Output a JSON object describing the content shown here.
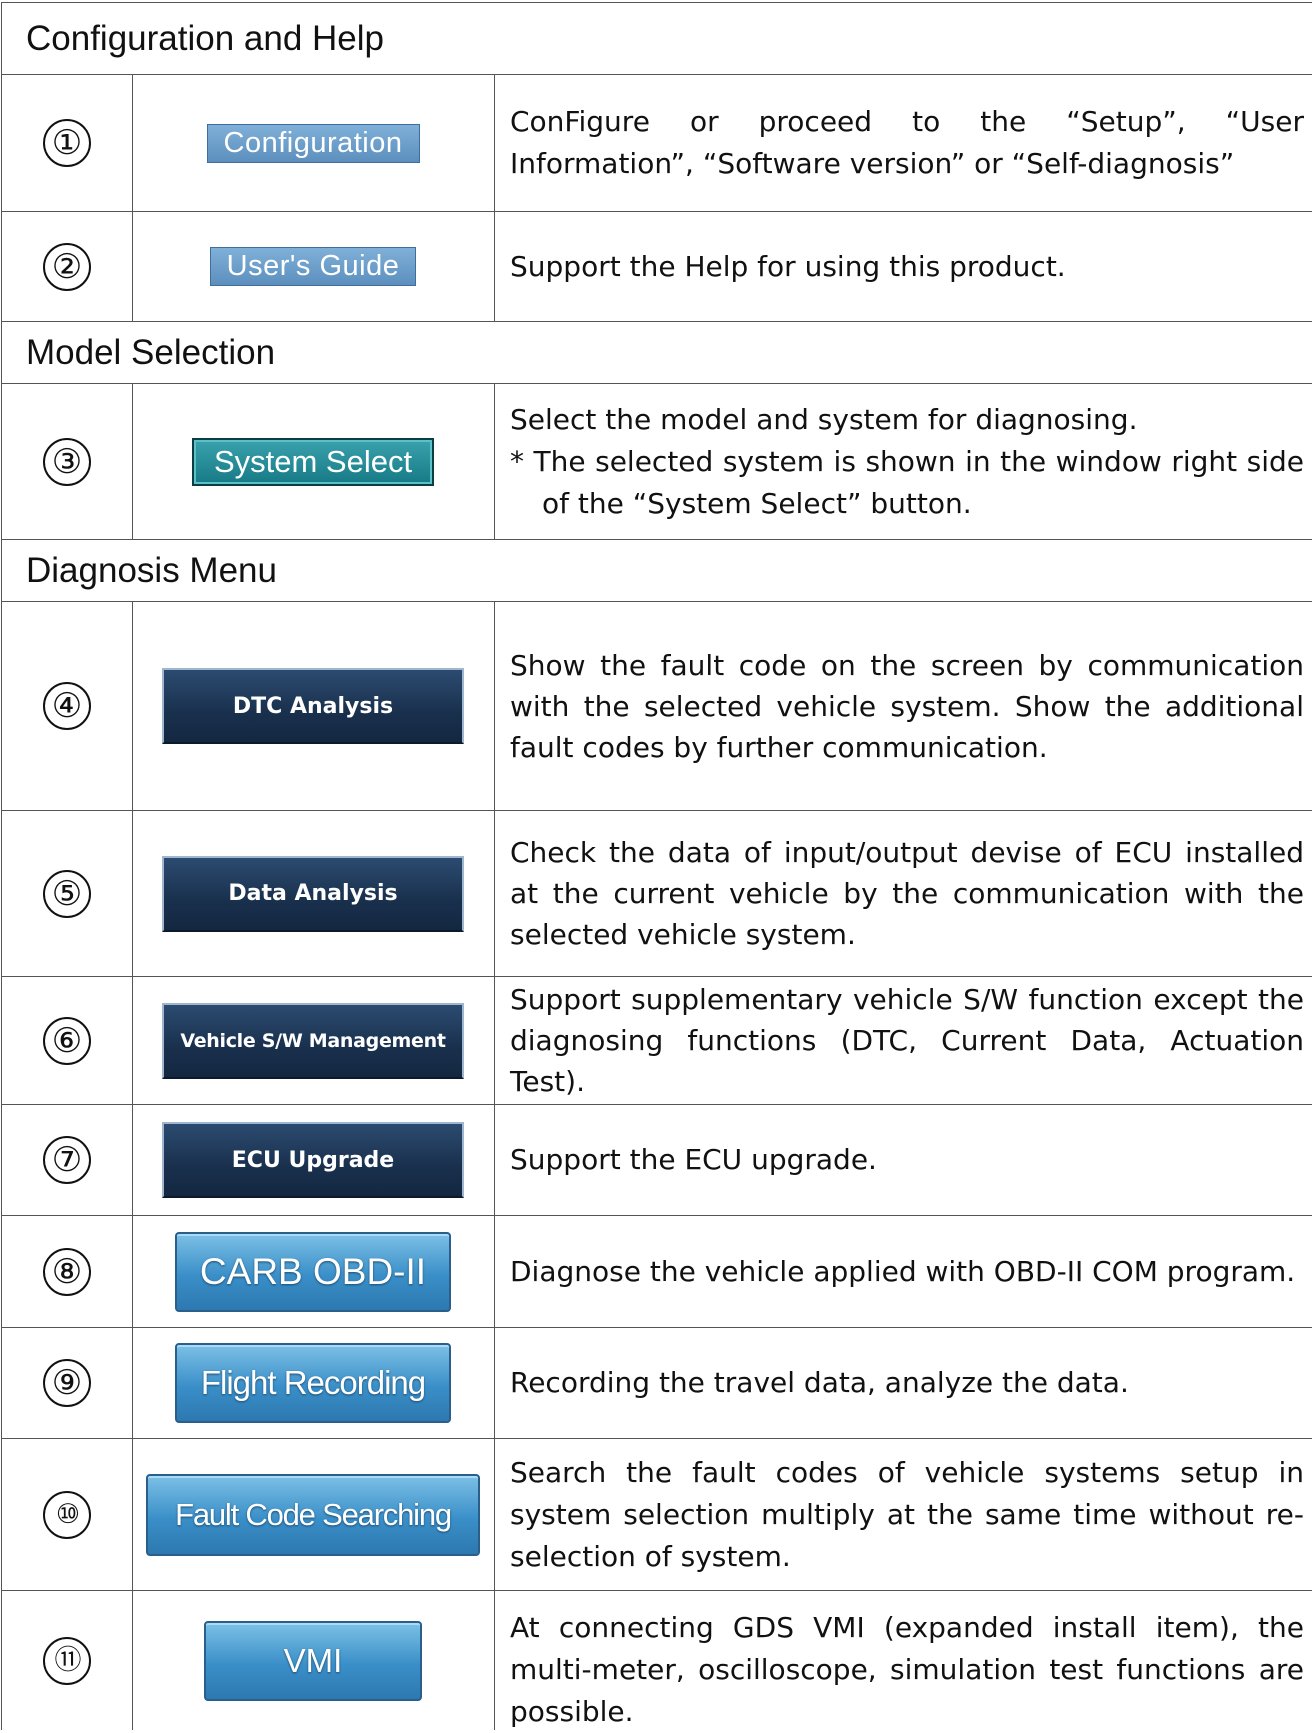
{
  "sections": {
    "config_help": "Configuration and Help",
    "model_selection": "Model Selection",
    "diagnosis_menu": "Diagnosis Menu"
  },
  "rows": [
    {
      "num": "①",
      "button": "Configuration",
      "desc": "ConFigure or proceed to the “Setup”, “User Information”, “Software version” or “Self-diagnosis”"
    },
    {
      "num": "②",
      "button": "User's Guide",
      "desc": "Support the Help for using this product."
    },
    {
      "num": "③",
      "button": "System Select",
      "desc": "Select the model and system for diagnosing.",
      "note": "* The selected system is shown in the window right side of the “System Select” button."
    },
    {
      "num": "④",
      "button": "DTC Analysis",
      "desc": "Show the fault code on the screen by communication with the selected vehicle system. Show the additional fault codes by further communication."
    },
    {
      "num": "⑤",
      "button": "Data Analysis",
      "desc": "Check the data of input/output devise of ECU installed at the current vehicle by the communication with the selected vehicle system."
    },
    {
      "num": "⑥",
      "button": "Vehicle S/W Management",
      "desc": "Support supplementary vehicle S/W function except the diagnosing functions (DTC, Current Data, Actuation Test)."
    },
    {
      "num": "⑦",
      "button": "ECU Upgrade",
      "desc": "Support the ECU upgrade."
    },
    {
      "num": "⑧",
      "button": "CARB OBD-II",
      "desc": "Diagnose the vehicle applied with OBD-II COM program."
    },
    {
      "num": "⑨",
      "button": "Flight Recording",
      "desc": "Recording the travel data, analyze the data."
    },
    {
      "num": "⑩",
      "button": "Fault Code Searching",
      "desc": "Search the fault codes of vehicle systems setup in system selection multiply at the same time without re-selection of system."
    },
    {
      "num": "⑪",
      "button": "VMI",
      "desc": "At connecting GDS VMI (expanded install item), the multi-meter, oscilloscope, simulation test functions are possible."
    }
  ]
}
